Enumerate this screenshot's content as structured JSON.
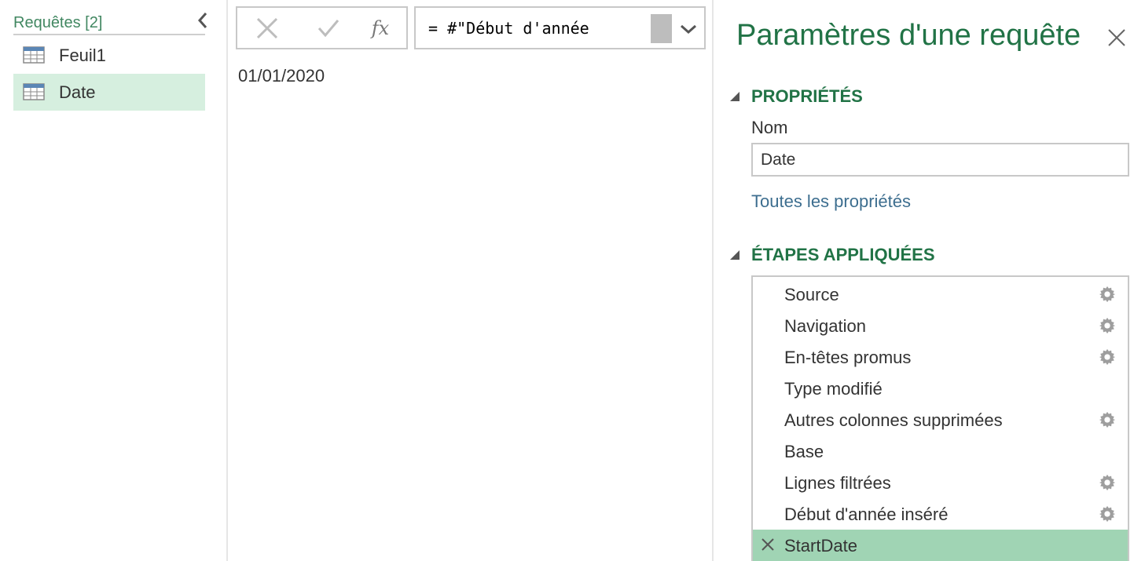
{
  "queries": {
    "title": "Requêtes [2]",
    "items": [
      {
        "label": "Feuil1",
        "icon": "table-icon",
        "selected": false
      },
      {
        "label": "Date",
        "icon": "table-icon",
        "selected": true
      }
    ]
  },
  "formula_bar": {
    "cancel_icon": "close-icon",
    "commit_icon": "checkmark-icon",
    "fx_label": "fx",
    "formula": "= #\"Début d'année"
  },
  "preview": {
    "value": "01/01/2020"
  },
  "settings": {
    "title": "Paramètres d'une requête",
    "properties_heading": "PROPRIÉTÉS",
    "name_label": "Nom",
    "name_value": "Date",
    "all_properties_link": "Toutes les propriétés",
    "steps_heading": "ÉTAPES APPLIQUÉES",
    "steps": [
      {
        "label": "Source",
        "has_settings": true
      },
      {
        "label": "Navigation",
        "has_settings": true
      },
      {
        "label": "En-têtes promus",
        "has_settings": true
      },
      {
        "label": "Type modifié",
        "has_settings": false
      },
      {
        "label": "Autres colonnes supprimées",
        "has_settings": true
      },
      {
        "label": "Base",
        "has_settings": false
      },
      {
        "label": "Lignes filtrées",
        "has_settings": true
      },
      {
        "label": "Début d'année inséré",
        "has_settings": true
      },
      {
        "label": "StartDate",
        "has_settings": false,
        "selected": true
      }
    ]
  },
  "colors": {
    "accent_green": "#217346",
    "selected_query_bg": "#d6efdf",
    "selected_step_bg": "#a0d4b4",
    "link_blue": "#3d6e8f"
  }
}
